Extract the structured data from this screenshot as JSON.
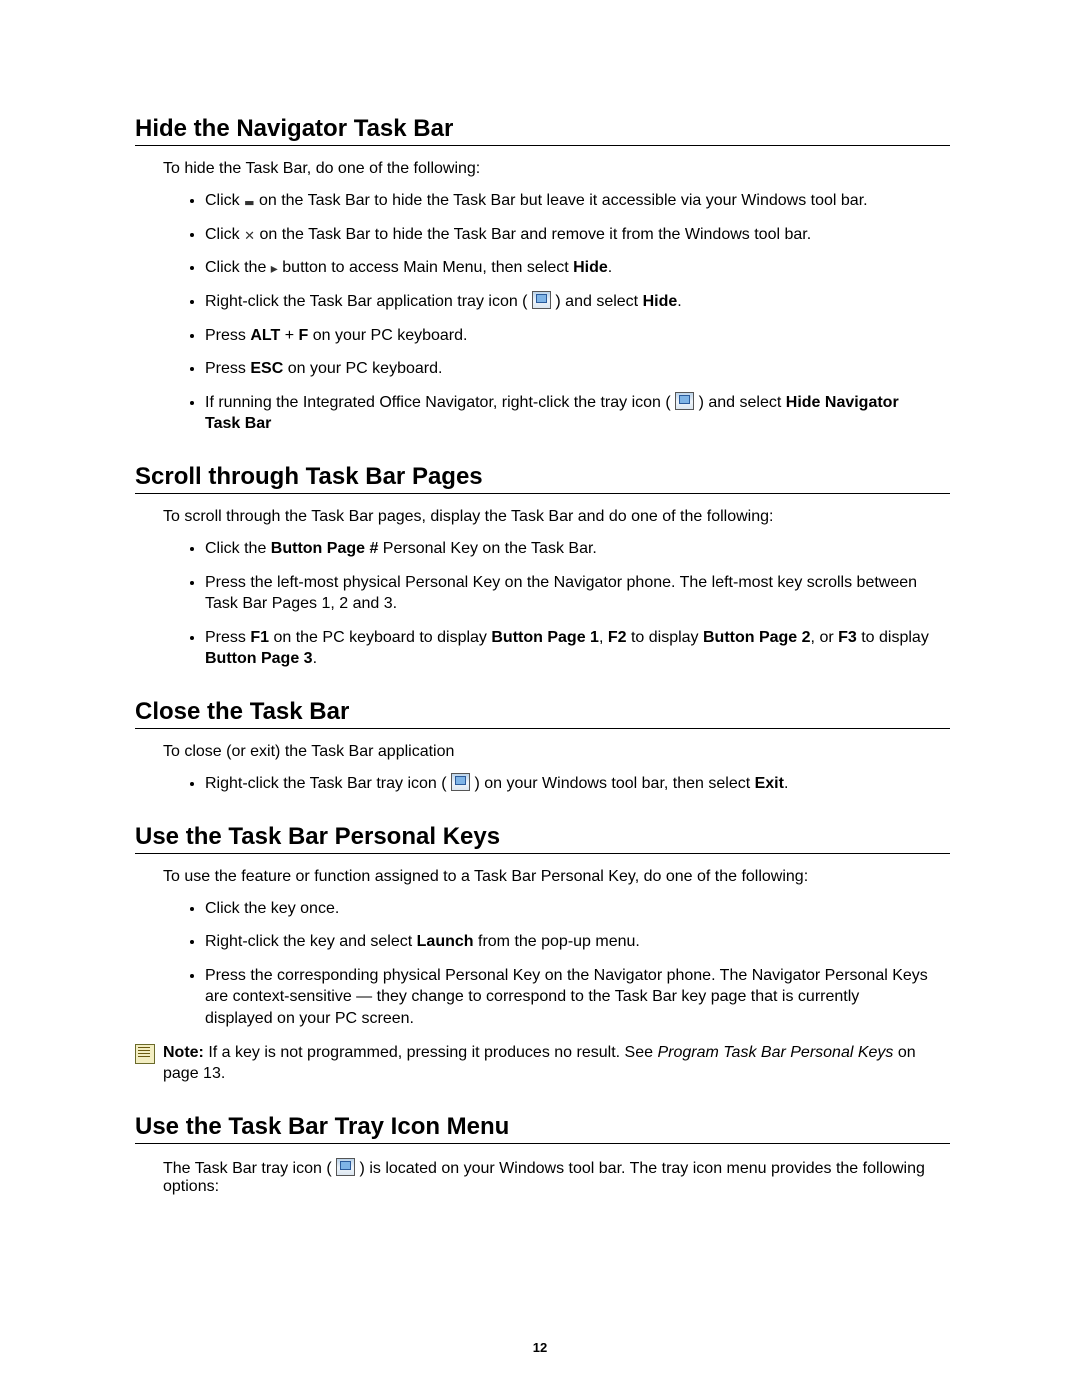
{
  "page_number": "12",
  "sections": {
    "hide": {
      "title": "Hide the Navigator Task Bar",
      "intro": "To hide the Task Bar, do one of the following:",
      "b1a": "Click ",
      "b1b": " on the Task Bar to hide the Task Bar but leave it accessible via your Windows tool bar.",
      "b2a": "Click ",
      "b2b": " on the Task Bar to hide the Task Bar and remove it from the Windows tool bar.",
      "b3a": "Click the ",
      "b3b": " button to access Main Menu, then select ",
      "b3c": "Hide",
      "b3d": ".",
      "b4a": "Right-click the Task Bar application tray icon ( ",
      "b4b": " ) and select ",
      "b4c": "Hide",
      "b4d": ".",
      "b5a": "Press ",
      "b5b": "ALT",
      "b5c": " + ",
      "b5d": "F",
      "b5e": " on your PC keyboard.",
      "b6a": "Press ",
      "b6b": "ESC",
      "b6c": " on your PC keyboard.",
      "b7a": "If running the Integrated Office Navigator, right-click the tray icon ( ",
      "b7b": " ) and select ",
      "b7c": "Hide Navigator Task Bar"
    },
    "scroll": {
      "title": "Scroll through Task Bar Pages",
      "intro": "To scroll through the Task Bar pages, display the Task Bar and do one of the following:",
      "b1a": "Click the ",
      "b1b": "Button Page #",
      "b1c": " Personal Key on the Task Bar.",
      "b2": "Press the left-most physical Personal Key on the Navigator phone. The left-most key scrolls between Task Bar Pages 1, 2 and 3.",
      "b3a": "Press ",
      "b3b": "F1",
      "b3c": " on the PC keyboard to display ",
      "b3d": "Button Page 1",
      "b3e": ", ",
      "b3f": "F2",
      "b3g": " to display ",
      "b3h": "Button Page 2",
      "b3i": ", or ",
      "b3j": "F3",
      "b3k": " to display ",
      "b3l": "Button Page 3",
      "b3m": "."
    },
    "close": {
      "title": "Close the Task Bar",
      "intro": "To close (or exit) the Task Bar application",
      "b1a": "Right-click the Task Bar tray icon ( ",
      "b1b": " ) on your Windows tool bar, then select ",
      "b1c": "Exit",
      "b1d": "."
    },
    "personal": {
      "title": "Use the Task Bar Personal Keys",
      "intro": "To use the feature or function assigned to a Task Bar Personal Key, do one of the following:",
      "b1": "Click the key once.",
      "b2a": "Right-click the key and select ",
      "b2b": "Launch",
      "b2c": " from the pop-up menu.",
      "b3": "Press the corresponding physical Personal Key on the Navigator phone. The Navigator Personal Keys are context-sensitive — they change to correspond to the Task Bar key page that is currently displayed on your PC screen.",
      "note_a": "Note:",
      "note_b": " If a key is not programmed, pressing it produces no result. See ",
      "note_c": "Program Task Bar Personal Keys",
      "note_d": " on page 13."
    },
    "traymenu": {
      "title": "Use the Task Bar Tray Icon Menu",
      "intro_a": "The Task Bar tray icon ( ",
      "intro_b": " ) is located on your Windows tool bar.  The tray icon menu provides the following options:"
    }
  }
}
